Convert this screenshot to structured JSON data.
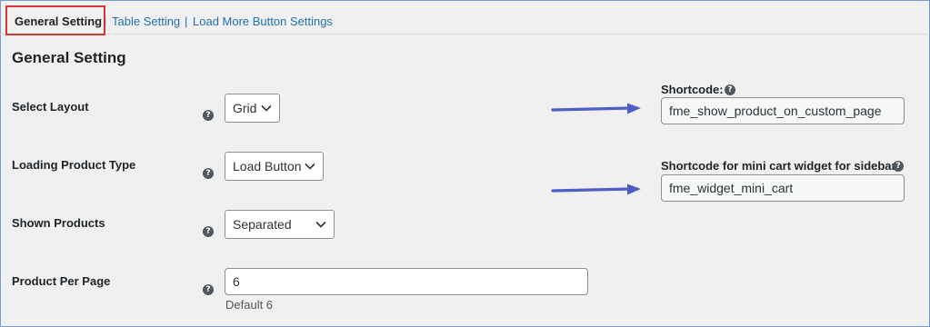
{
  "tabs": {
    "general": "General Setting",
    "separator": "|",
    "table": "Table Setting",
    "load_more": "Load More Button Settings"
  },
  "section_title": "General Setting",
  "fields": {
    "layout": {
      "label": "Select Layout",
      "value": "Grid"
    },
    "loading_type": {
      "label": "Loading Product Type",
      "value": "Load Button"
    },
    "shown_products": {
      "label": "Shown Products",
      "value": "Separated"
    },
    "per_page": {
      "label": "Product Per Page",
      "value": "6",
      "description": "Default 6"
    }
  },
  "shortcodes": {
    "main": {
      "title": "Shortcode:",
      "value": "fme_show_product_on_custom_page"
    },
    "mini_cart": {
      "title": "Shortcode for mini cart widget for sidebar",
      "value": "fme_widget_mini_cart"
    }
  },
  "help_glyph": "?",
  "colors": {
    "link": "#2271b1",
    "highlight": "#d63638",
    "arrow": "#4f5ec4"
  }
}
